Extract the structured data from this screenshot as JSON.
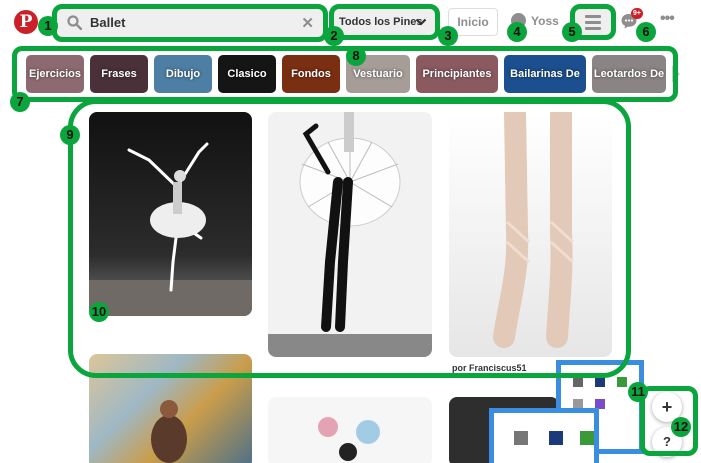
{
  "header": {
    "search_value": "Ballet",
    "clear_glyph": "✕",
    "filter_label": "Todos los Pines",
    "home_label": "Inicio",
    "user_name": "Yoss",
    "notification_count": "9+",
    "more_glyph": "•••"
  },
  "guides": [
    {
      "label": "Ejercicios",
      "color": "#8d6a72"
    },
    {
      "label": "Frases",
      "color": "#4a3038"
    },
    {
      "label": "Dibujo",
      "color": "#4d7ea3"
    },
    {
      "label": "Clasico",
      "color": "#151515"
    },
    {
      "label": "Fondos",
      "color": "#7a2e12"
    },
    {
      "label": "Vestuario",
      "color": "#a69c98"
    },
    {
      "label": "Principiantes",
      "color": "#8a5a60"
    },
    {
      "label": "Bailarinas De",
      "color": "#1c4f8f"
    },
    {
      "label": "Leotardos De",
      "color": "#8a8584"
    }
  ],
  "pins": [
    {
      "name": "pin-ballerina-arabesque",
      "caption": ""
    },
    {
      "name": "pin-tutu-backbend",
      "caption": ""
    },
    {
      "name": "pin-pointe-shoes",
      "caption": "por Franciscus51"
    },
    {
      "name": "pin-painting-ballerina",
      "caption": ""
    },
    {
      "name": "pin-watercolor-dancer",
      "caption": ""
    },
    {
      "name": "pin-dark-photo",
      "caption": ""
    }
  ],
  "side_buttons": {
    "add_glyph": "+",
    "help_glyph": "?"
  },
  "annotations": [
    "1",
    "2",
    "3",
    "4",
    "5",
    "6",
    "7",
    "8",
    "9",
    "10",
    "11",
    "12"
  ],
  "colors": {
    "brand": "#cb2027",
    "annotation": "#0aa53c",
    "tray_border": "#3b8de0"
  }
}
